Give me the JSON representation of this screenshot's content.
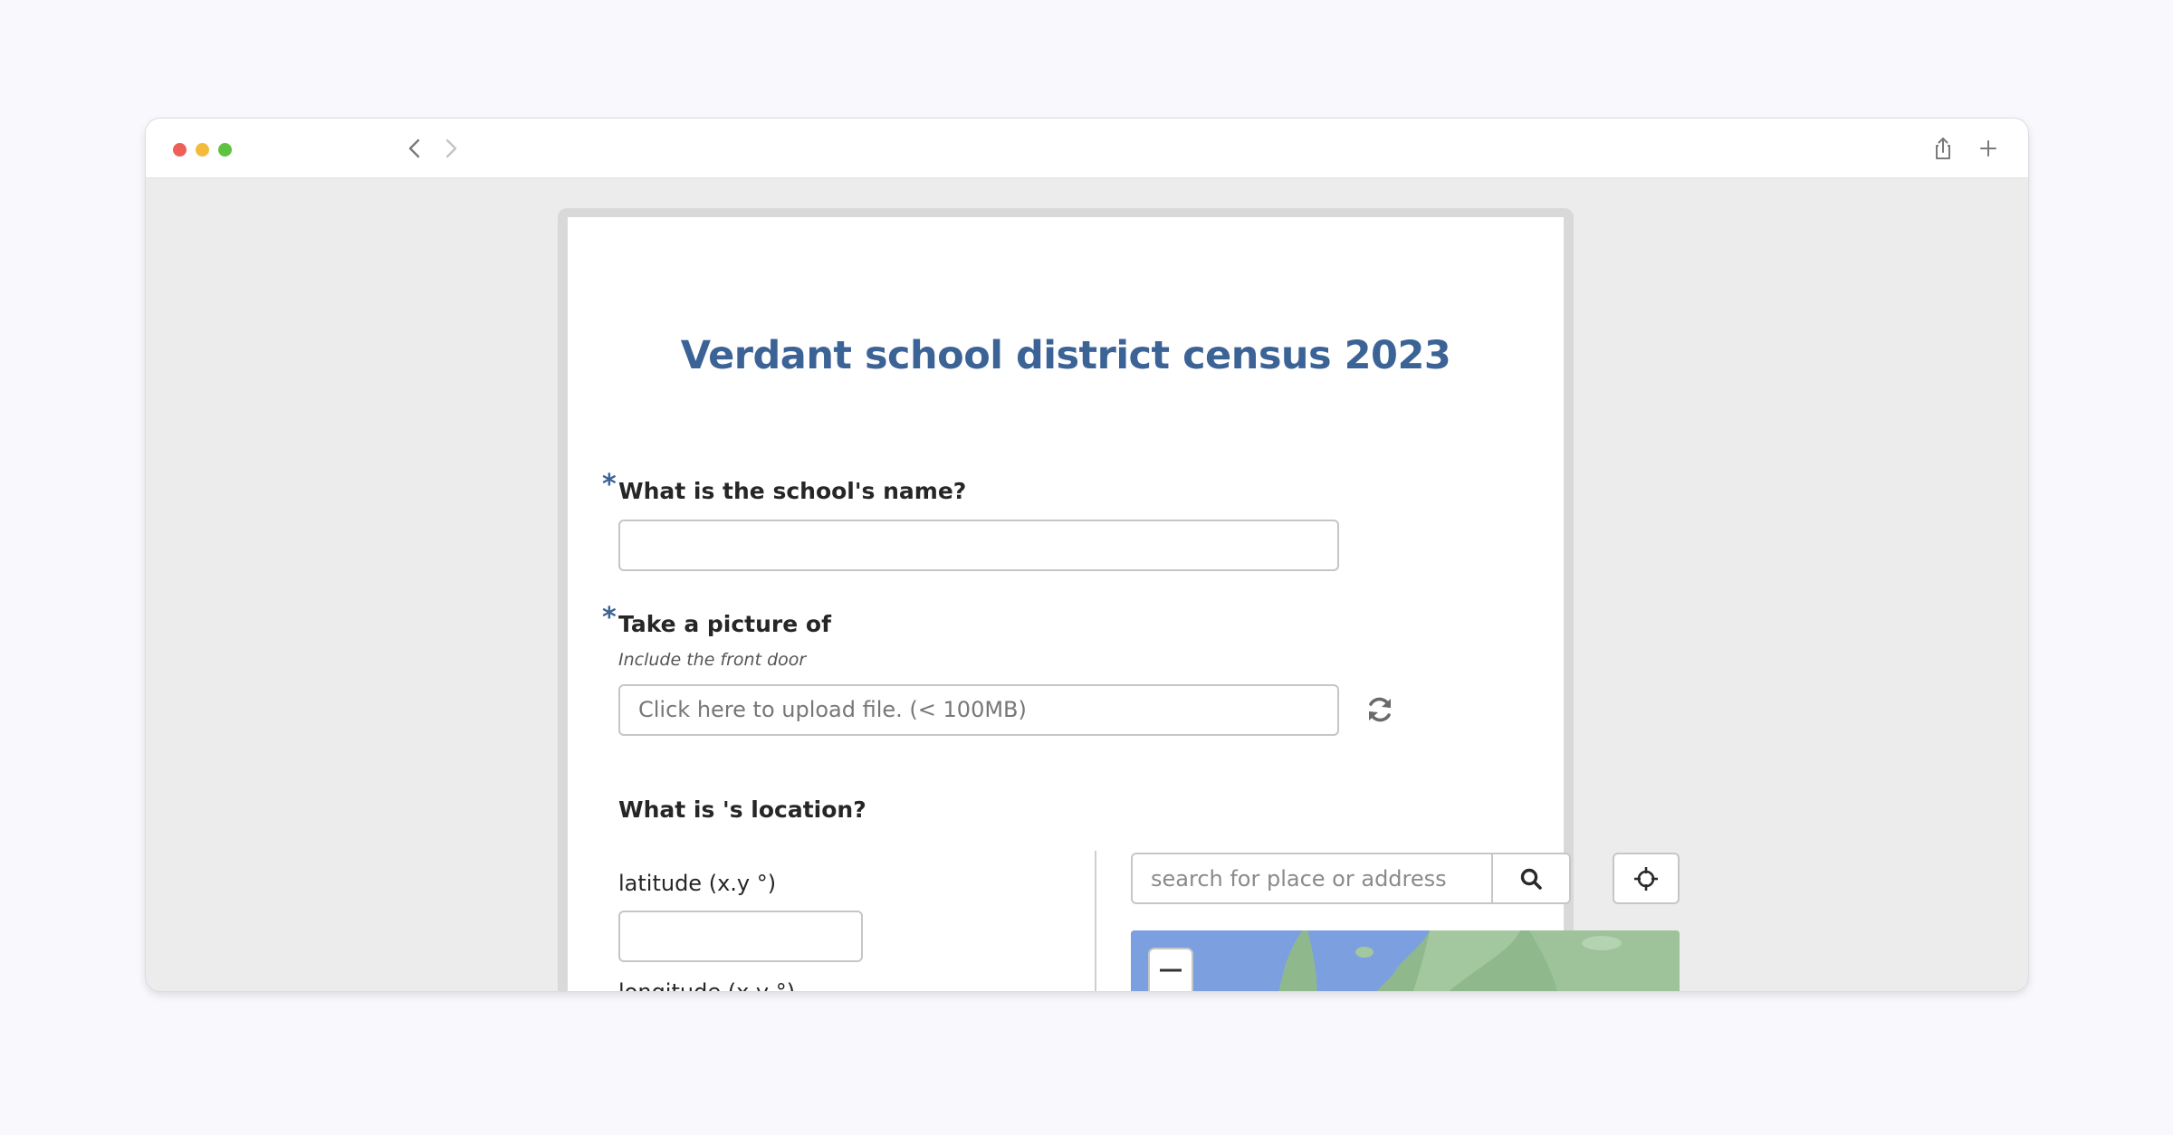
{
  "browser": {
    "icons": {
      "back": "chevron-left-icon",
      "forward": "chevron-right-icon",
      "share": "share-icon",
      "new_tab": "plus-icon"
    }
  },
  "form": {
    "title": "Verdant school district census 2023",
    "accent_color": "#3c6396",
    "school_name": {
      "required_mark": "*",
      "label": "What is the school's name?",
      "value": ""
    },
    "picture": {
      "required_mark": "*",
      "label": "Take a picture of",
      "hint": "Include the front door",
      "upload_text": "Click here to upload file. (< 100MB)",
      "refresh_icon": "refresh-icon"
    },
    "location": {
      "label": "What is 's location?",
      "latitude_label": "latitude (x.y °)",
      "latitude_value": "",
      "longitude_label": "longitude (x.y °)",
      "search_placeholder": "search for place or address",
      "search_icon": "search-icon",
      "locate_icon": "crosshair-icon"
    }
  }
}
